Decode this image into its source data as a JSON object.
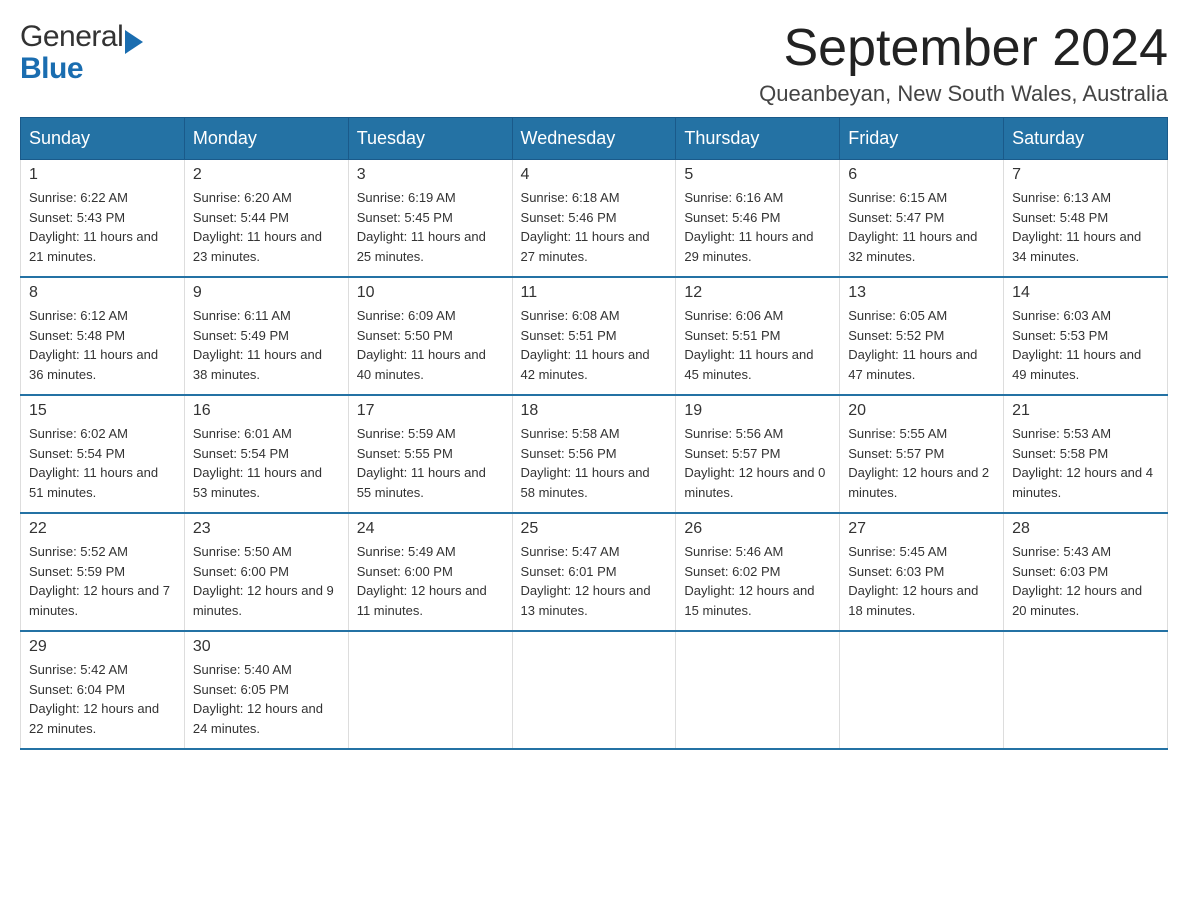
{
  "header": {
    "logo_line1": "General",
    "logo_line2": "Blue",
    "month_title": "September 2024",
    "location": "Queanbeyan, New South Wales, Australia"
  },
  "days_of_week": [
    "Sunday",
    "Monday",
    "Tuesday",
    "Wednesday",
    "Thursday",
    "Friday",
    "Saturday"
  ],
  "weeks": [
    [
      {
        "date": "1",
        "sunrise": "6:22 AM",
        "sunset": "5:43 PM",
        "daylight": "11 hours and 21 minutes."
      },
      {
        "date": "2",
        "sunrise": "6:20 AM",
        "sunset": "5:44 PM",
        "daylight": "11 hours and 23 minutes."
      },
      {
        "date": "3",
        "sunrise": "6:19 AM",
        "sunset": "5:45 PM",
        "daylight": "11 hours and 25 minutes."
      },
      {
        "date": "4",
        "sunrise": "6:18 AM",
        "sunset": "5:46 PM",
        "daylight": "11 hours and 27 minutes."
      },
      {
        "date": "5",
        "sunrise": "6:16 AM",
        "sunset": "5:46 PM",
        "daylight": "11 hours and 29 minutes."
      },
      {
        "date": "6",
        "sunrise": "6:15 AM",
        "sunset": "5:47 PM",
        "daylight": "11 hours and 32 minutes."
      },
      {
        "date": "7",
        "sunrise": "6:13 AM",
        "sunset": "5:48 PM",
        "daylight": "11 hours and 34 minutes."
      }
    ],
    [
      {
        "date": "8",
        "sunrise": "6:12 AM",
        "sunset": "5:48 PM",
        "daylight": "11 hours and 36 minutes."
      },
      {
        "date": "9",
        "sunrise": "6:11 AM",
        "sunset": "5:49 PM",
        "daylight": "11 hours and 38 minutes."
      },
      {
        "date": "10",
        "sunrise": "6:09 AM",
        "sunset": "5:50 PM",
        "daylight": "11 hours and 40 minutes."
      },
      {
        "date": "11",
        "sunrise": "6:08 AM",
        "sunset": "5:51 PM",
        "daylight": "11 hours and 42 minutes."
      },
      {
        "date": "12",
        "sunrise": "6:06 AM",
        "sunset": "5:51 PM",
        "daylight": "11 hours and 45 minutes."
      },
      {
        "date": "13",
        "sunrise": "6:05 AM",
        "sunset": "5:52 PM",
        "daylight": "11 hours and 47 minutes."
      },
      {
        "date": "14",
        "sunrise": "6:03 AM",
        "sunset": "5:53 PM",
        "daylight": "11 hours and 49 minutes."
      }
    ],
    [
      {
        "date": "15",
        "sunrise": "6:02 AM",
        "sunset": "5:54 PM",
        "daylight": "11 hours and 51 minutes."
      },
      {
        "date": "16",
        "sunrise": "6:01 AM",
        "sunset": "5:54 PM",
        "daylight": "11 hours and 53 minutes."
      },
      {
        "date": "17",
        "sunrise": "5:59 AM",
        "sunset": "5:55 PM",
        "daylight": "11 hours and 55 minutes."
      },
      {
        "date": "18",
        "sunrise": "5:58 AM",
        "sunset": "5:56 PM",
        "daylight": "11 hours and 58 minutes."
      },
      {
        "date": "19",
        "sunrise": "5:56 AM",
        "sunset": "5:57 PM",
        "daylight": "12 hours and 0 minutes."
      },
      {
        "date": "20",
        "sunrise": "5:55 AM",
        "sunset": "5:57 PM",
        "daylight": "12 hours and 2 minutes."
      },
      {
        "date": "21",
        "sunrise": "5:53 AM",
        "sunset": "5:58 PM",
        "daylight": "12 hours and 4 minutes."
      }
    ],
    [
      {
        "date": "22",
        "sunrise": "5:52 AM",
        "sunset": "5:59 PM",
        "daylight": "12 hours and 7 minutes."
      },
      {
        "date": "23",
        "sunrise": "5:50 AM",
        "sunset": "6:00 PM",
        "daylight": "12 hours and 9 minutes."
      },
      {
        "date": "24",
        "sunrise": "5:49 AM",
        "sunset": "6:00 PM",
        "daylight": "12 hours and 11 minutes."
      },
      {
        "date": "25",
        "sunrise": "5:47 AM",
        "sunset": "6:01 PM",
        "daylight": "12 hours and 13 minutes."
      },
      {
        "date": "26",
        "sunrise": "5:46 AM",
        "sunset": "6:02 PM",
        "daylight": "12 hours and 15 minutes."
      },
      {
        "date": "27",
        "sunrise": "5:45 AM",
        "sunset": "6:03 PM",
        "daylight": "12 hours and 18 minutes."
      },
      {
        "date": "28",
        "sunrise": "5:43 AM",
        "sunset": "6:03 PM",
        "daylight": "12 hours and 20 minutes."
      }
    ],
    [
      {
        "date": "29",
        "sunrise": "5:42 AM",
        "sunset": "6:04 PM",
        "daylight": "12 hours and 22 minutes."
      },
      {
        "date": "30",
        "sunrise": "5:40 AM",
        "sunset": "6:05 PM",
        "daylight": "12 hours and 24 minutes."
      },
      null,
      null,
      null,
      null,
      null
    ]
  ]
}
